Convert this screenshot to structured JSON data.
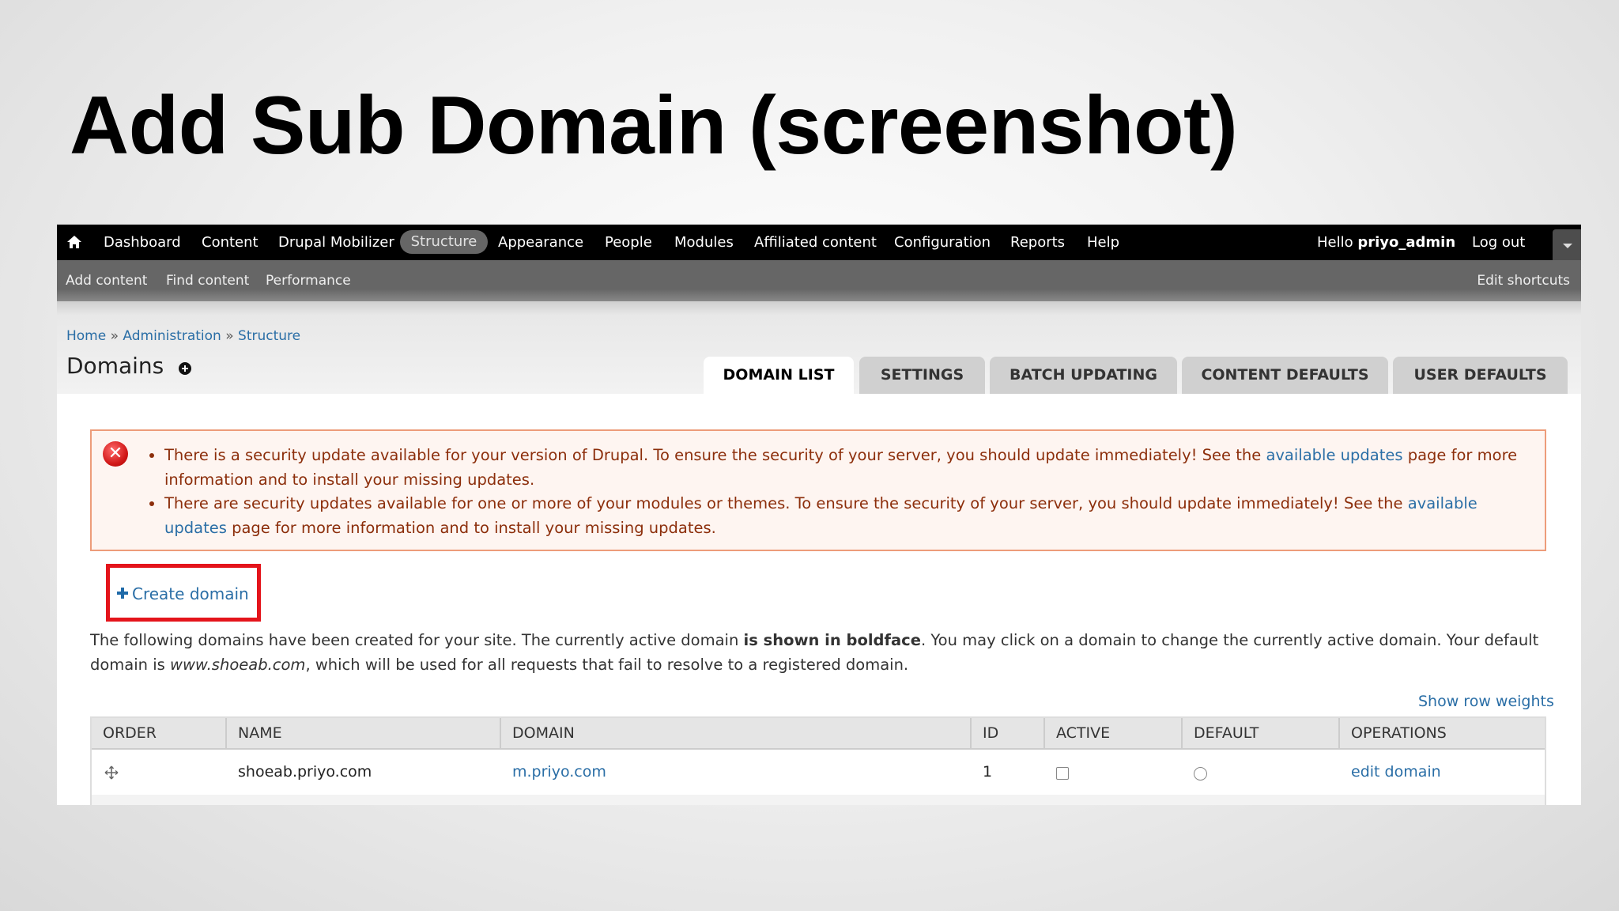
{
  "slide": {
    "title": "Add Sub Domain (screenshot)"
  },
  "toolbar": {
    "items": [
      "Dashboard",
      "Content",
      "Drupal Mobilizer",
      "Structure",
      "Appearance",
      "People",
      "Modules",
      "Affiliated content",
      "Configuration",
      "Reports",
      "Help"
    ],
    "active": "Structure",
    "hello_prefix": "Hello ",
    "username": "priyo_admin",
    "logout": "Log out"
  },
  "shortcuts": {
    "items": [
      "Add content",
      "Find content",
      "Performance"
    ],
    "edit": "Edit shortcuts"
  },
  "breadcrumb": {
    "items": [
      "Home",
      "Administration",
      "Structure"
    ],
    "separator": "»"
  },
  "page_title": "Domains",
  "tabs": [
    "DOMAIN LIST",
    "SETTINGS",
    "BATCH UPDATING",
    "CONTENT DEFAULTS",
    "USER DEFAULTS"
  ],
  "messages": {
    "m1_text": "There is a security update available for your version of Drupal. To ensure the security of your server, you should update immediately! See the ",
    "m1_link": "available updates",
    "m1_tail": " page for more information and to install your missing updates.",
    "m2_text": "There are security updates available for one or more of your modules or themes. To ensure the security of your server, you should update immediately! See the ",
    "m2_link": "available updates",
    "m2_tail": " page for more information and to install your missing updates."
  },
  "create_domain": "Create domain",
  "description": {
    "part1": "The following domains have been created for your site. The currently active domain ",
    "bold": "is shown in boldface",
    "part2": ". You may click on a domain to change the currently active domain. Your default domain is ",
    "italic": "www.shoeab.com",
    "part3": ", which will be used for all requests that fail to resolve to a registered domain."
  },
  "show_row_weights": "Show row weights",
  "table": {
    "headers": [
      "ORDER",
      "NAME",
      "DOMAIN",
      "ID",
      "ACTIVE",
      "DEFAULT",
      "OPERATIONS"
    ],
    "rows": [
      {
        "name": "shoeab.priyo.com",
        "domain": "m.priyo.com",
        "id": "1",
        "active": false,
        "default": false,
        "operation": "edit domain"
      }
    ]
  },
  "colors": {
    "toolbar": "#000000",
    "link": "#2a6ea6",
    "error_border": "#ed9c7a",
    "highlight": "#e4141b"
  }
}
